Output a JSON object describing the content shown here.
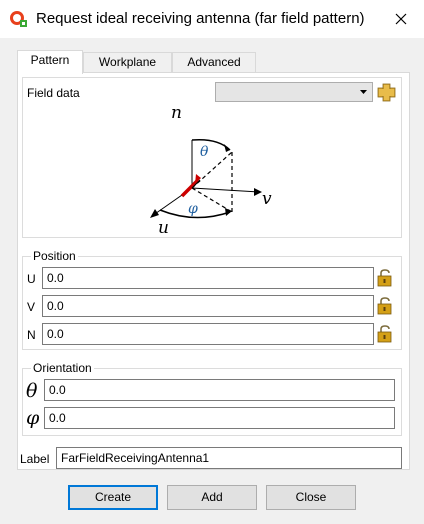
{
  "window": {
    "title": "Request ideal receiving antenna (far field pattern)",
    "icon": "cadfeko-app-icon",
    "close_icon": "close-icon"
  },
  "tabs": [
    {
      "label": "Pattern",
      "active": true
    },
    {
      "label": "Workplane",
      "active": false
    },
    {
      "label": "Advanced",
      "active": false
    }
  ],
  "field_data": {
    "label": "Field data",
    "value": "",
    "pick_icon": "import-plus-icon"
  },
  "diagram": {
    "axis_n": "n",
    "axis_u": "u",
    "axis_v": "v",
    "theta": "θ",
    "phi": "φ"
  },
  "position": {
    "title": "Position",
    "u_label": "U",
    "u_value": "0.0",
    "v_label": "V",
    "v_value": "0.0",
    "n_label": "N",
    "n_value": "0.0",
    "lock_icon": "unlocked-padlock-icon"
  },
  "orientation": {
    "title": "Orientation",
    "theta_label": "θ",
    "theta_value": "0.0",
    "phi_label": "φ",
    "phi_value": "0.0"
  },
  "label_field": {
    "label": "Label",
    "value": "FarFieldReceivingAntenna1"
  },
  "buttons": {
    "create": "Create",
    "add": "Add",
    "close": "Close"
  },
  "colors": {
    "accent": "#0078d7",
    "theta_blue": "#1f5f9f",
    "antenna_red": "#cc0000",
    "lock_gold": "#d4a017"
  }
}
